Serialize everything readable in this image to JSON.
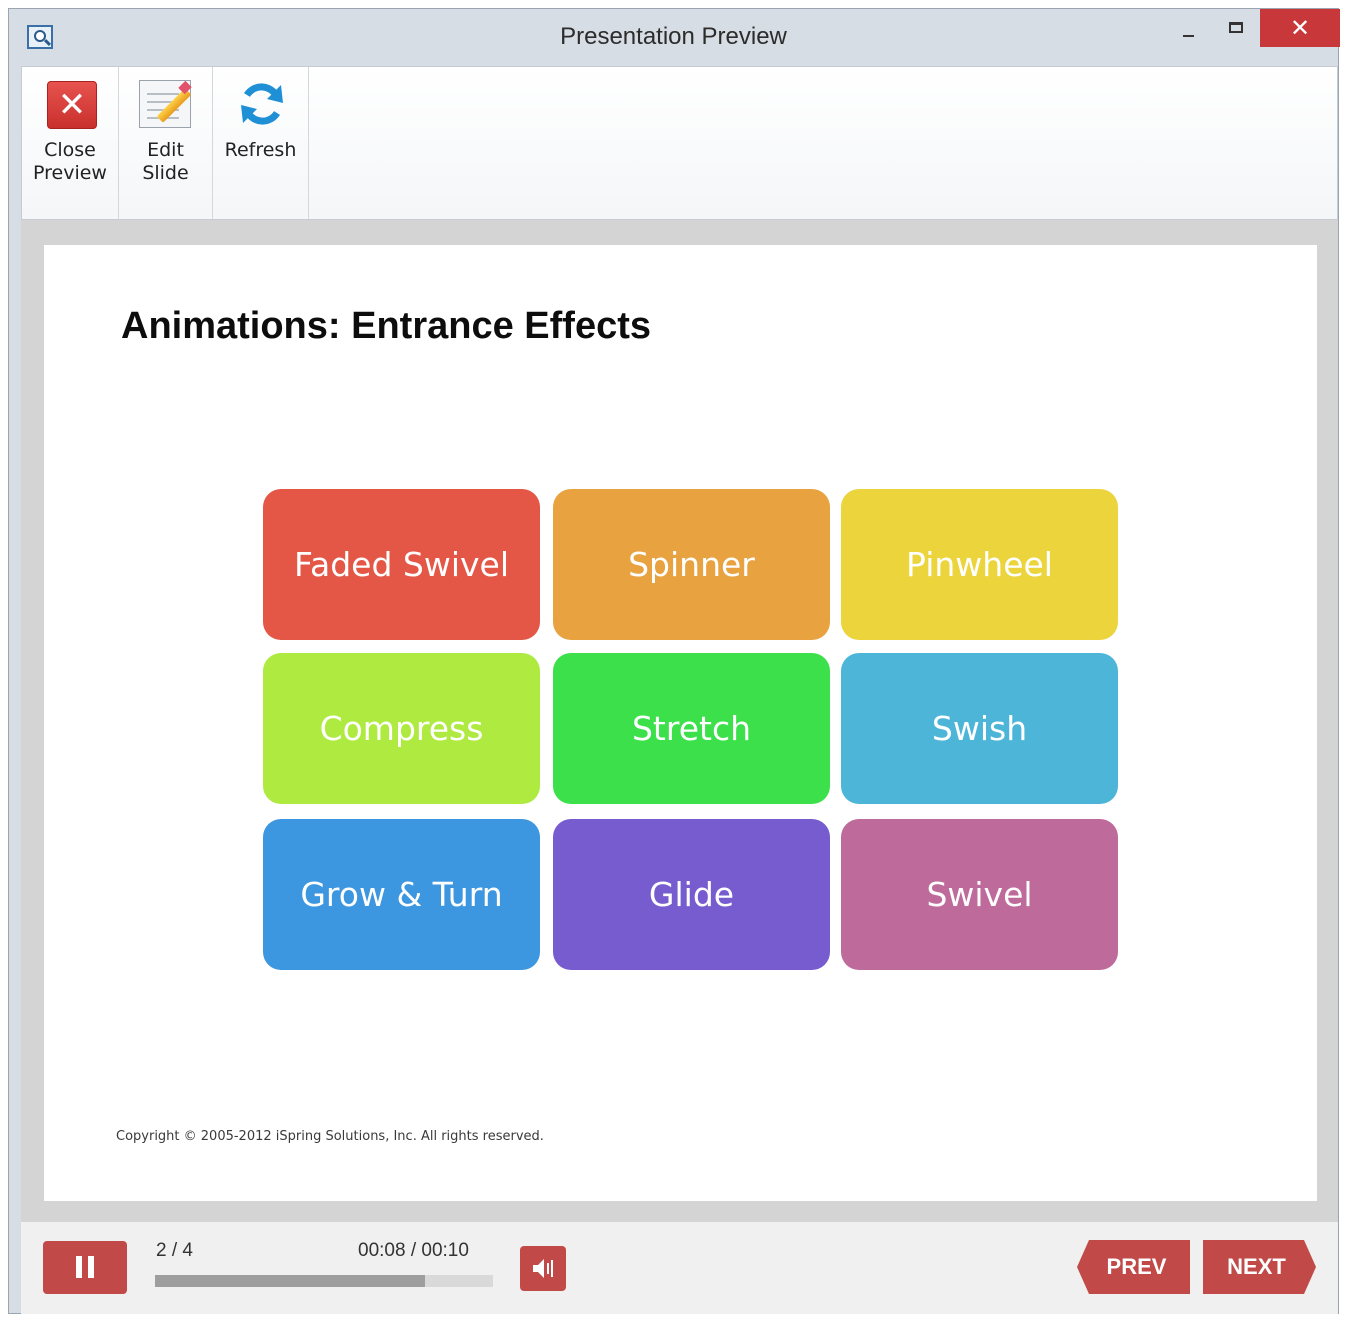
{
  "window": {
    "title": "Presentation Preview"
  },
  "toolbar": {
    "close_preview_label": "Close\nPreview",
    "edit_slide_label": "Edit\nSlide",
    "refresh_label": "Refresh"
  },
  "slide": {
    "title": "Animations: Entrance Effects",
    "tiles": [
      {
        "label": "Faded Swivel",
        "color": "#e45646"
      },
      {
        "label": "Spinner",
        "color": "#e8a340"
      },
      {
        "label": "Pinwheel",
        "color": "#ecd43c"
      },
      {
        "label": "Compress",
        "color": "#aeea40"
      },
      {
        "label": "Stretch",
        "color": "#3be04a"
      },
      {
        "label": "Swish",
        "color": "#4db6d8"
      },
      {
        "label": "Grow & Turn",
        "color": "#3c96e0"
      },
      {
        "label": "Glide",
        "color": "#765ccf"
      },
      {
        "label": "Swivel",
        "color": "#be6b9b"
      }
    ],
    "copyright": "Copyright © 2005-2012 iSpring Solutions, Inc. All rights reserved."
  },
  "player": {
    "slide_counter": "2 / 4",
    "time": "00:08 / 00:10",
    "progress_fraction": 0.8,
    "prev_label": "PREV",
    "next_label": "NEXT",
    "accent_color": "#c14a49"
  },
  "icons": {
    "app": "presentation-preview-icon",
    "close": "close-x-icon",
    "edit": "edit-pencil-icon",
    "refresh": "refresh-icon",
    "pause": "pause-icon",
    "volume": "speaker-icon"
  }
}
